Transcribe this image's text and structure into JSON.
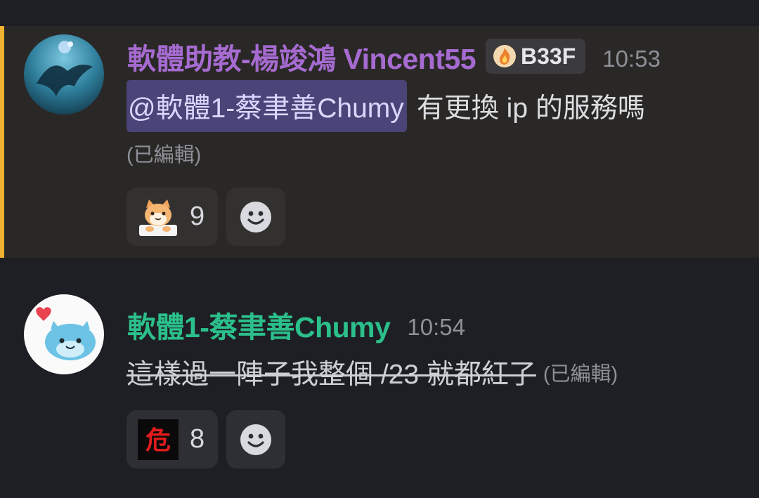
{
  "messages": [
    {
      "username": "軟體助教-楊竣鴻 Vincent55",
      "tag": "B33F",
      "time": "10:53",
      "mention": "@軟體1-蔡聿善Chumy",
      "text": "有更換 ip 的服務嗎",
      "edited": "(已編輯)",
      "reaction_emoji": "cat-emoji",
      "reaction_count": "9",
      "accent_color": "#f0b232",
      "name_color": "#a66bd1"
    },
    {
      "username": "軟體1-蔡聿善Chumy",
      "time": "10:54",
      "text": "這樣過一陣子我整個 /23 就都紅了",
      "edited": "(已編輯)",
      "reaction_emoji": "danger-emoji",
      "reaction_glyph": "危",
      "reaction_count": "8",
      "name_color": "#2bc08b"
    }
  ]
}
